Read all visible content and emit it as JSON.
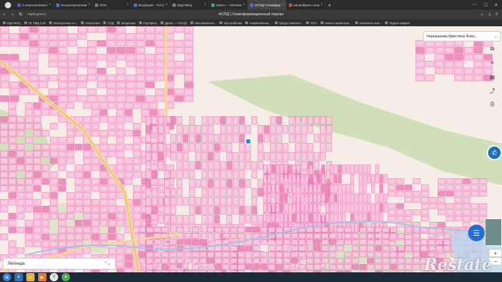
{
  "browser": {
    "tabs": [
      {
        "title": "4 непрочитанных чата",
        "icon": "chat-icon",
        "color": "purple",
        "active": false
      },
      {
        "title": "На рассмотрении : Все р...",
        "icon": "doc-icon",
        "color": "blue",
        "active": false
      },
      {
        "title": "ПОС",
        "icon": "doc-icon",
        "color": "gray",
        "active": false
      },
      {
        "title": "Входящие - Почта Mail",
        "icon": "mail-icon",
        "color": "blue",
        "active": false
      },
      {
        "title": "Digit МФЦ",
        "icon": "doc-icon",
        "color": "gray",
        "active": false
      },
      {
        "title": "Авито — Объявления на ...",
        "icon": "avito-icon",
        "color": "teal",
        "active": false
      },
      {
        "title": "НСПД | Геоинформацио...",
        "icon": "map-icon",
        "color": "blue",
        "active": true
      },
      {
        "title": "как выбрать слои в публ...",
        "icon": "search-icon",
        "color": "red",
        "active": false
      }
    ],
    "new_tab": "+",
    "url": "nspd.gov.ru",
    "page_title": "НСПД | Геоинформационный портал",
    "bookmarks": [
      "Digit МФЦ",
      "ПК ПВД 3.20",
      "Электронная оч...",
      "Аналитика",
      "СЭД",
      "Входящие",
      "Портфель",
      "Древо — Family",
      "Николаевская...",
      "Моя рабочая",
      "Нормативные...",
      "Предоставлени...",
      "ПОС",
      "Анкета-заявитель...",
      "Заполнить анк...",
      "Яндекс Маркет"
    ]
  },
  "map": {
    "user_name": "Чернышева Кристина Алек...",
    "legend_label": "Легенда",
    "tools": [
      "layers-icon",
      "ruler-icon",
      "print-icon",
      "share-icon",
      "printer-icon"
    ],
    "colors": {
      "ground": "#f6eee6",
      "parcel": "#e05aa0",
      "parcel_fill": "#f7c9df",
      "dense": "#e98ab8",
      "forest": "#c7dcb0",
      "road": "#f6d79a"
    }
  },
  "watermark": "Restate",
  "taskbar": [
    "start-icon",
    "ie-icon",
    "folder-icon",
    "media-icon",
    "yandex-icon",
    "chrome-icon"
  ]
}
